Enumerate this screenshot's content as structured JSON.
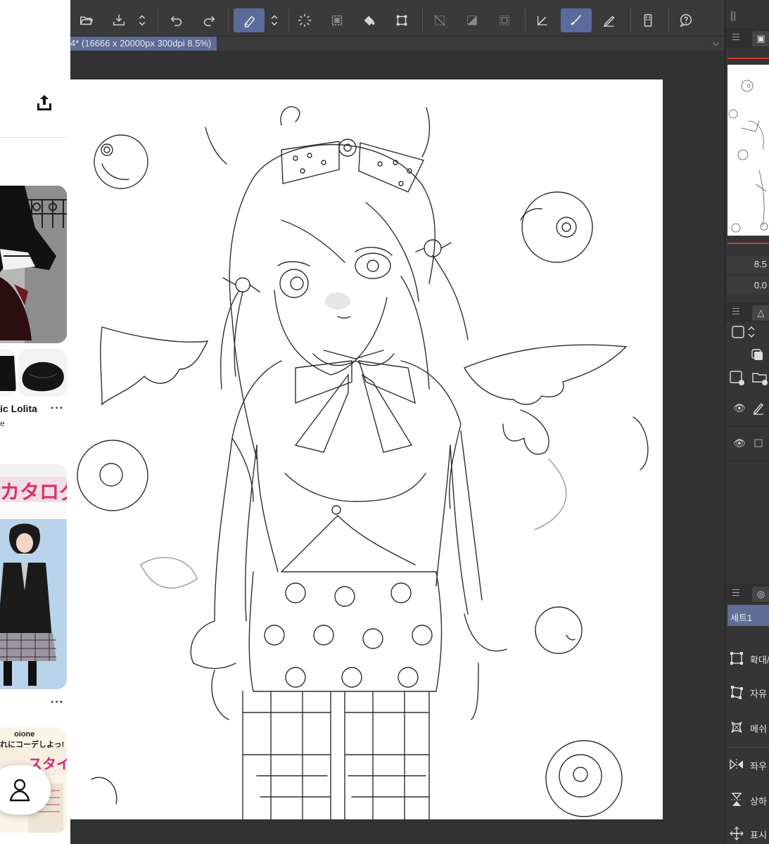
{
  "toolbar": {
    "buttons": [
      {
        "name": "open-file-icon"
      },
      {
        "name": "save-file-icon"
      },
      {
        "name": "updown-icon"
      },
      {
        "name": "undo-icon"
      },
      {
        "name": "redo-icon"
      },
      {
        "name": "eraser-icon",
        "active": true
      },
      {
        "name": "updown-icon"
      },
      {
        "name": "loading-spinner-icon"
      },
      {
        "name": "select-all-icon"
      },
      {
        "name": "fill-bucket-icon"
      },
      {
        "name": "transform-icon"
      },
      {
        "name": "deselect-icon"
      },
      {
        "name": "invert-selection-icon"
      },
      {
        "name": "show-selection-icon"
      },
      {
        "name": "ruler-pen-icon"
      },
      {
        "name": "brush-icon",
        "active": true
      },
      {
        "name": "pen-icon"
      },
      {
        "name": "smartphone-icon"
      },
      {
        "name": "help-icon"
      }
    ]
  },
  "document": {
    "tab_label": "4* (16666 x 20000px 300dpi 8.5%)"
  },
  "right_panel": {
    "zoom_value": "8.5",
    "rotation_value": "0.0",
    "set_tab_label": "세트1",
    "tools": [
      {
        "icon": "scale-icon",
        "label": "확대/"
      },
      {
        "icon": "free-transform-icon",
        "label": "자유"
      },
      {
        "icon": "mesh-icon",
        "label": "메쉬"
      },
      {
        "icon": "flip-horizontal-icon",
        "label": "좌우"
      },
      {
        "icon": "flip-vertical-icon",
        "label": "상하"
      },
      {
        "icon": "display-icon",
        "label": "표시"
      }
    ]
  },
  "left_panel": {
    "pin_title": "ic Lolita",
    "pin_sub": "e",
    "more_dots": "···",
    "magazine_1_title": "カタログ",
    "magazine_2_title": "スタイル",
    "magazine_2_banner": "れにコーデしよっ!",
    "magazine_2_brand": "oione"
  },
  "colors": {
    "accent": "#5b6b9b",
    "panel_dark": "#323232",
    "highlight_red": "#d9352b"
  }
}
